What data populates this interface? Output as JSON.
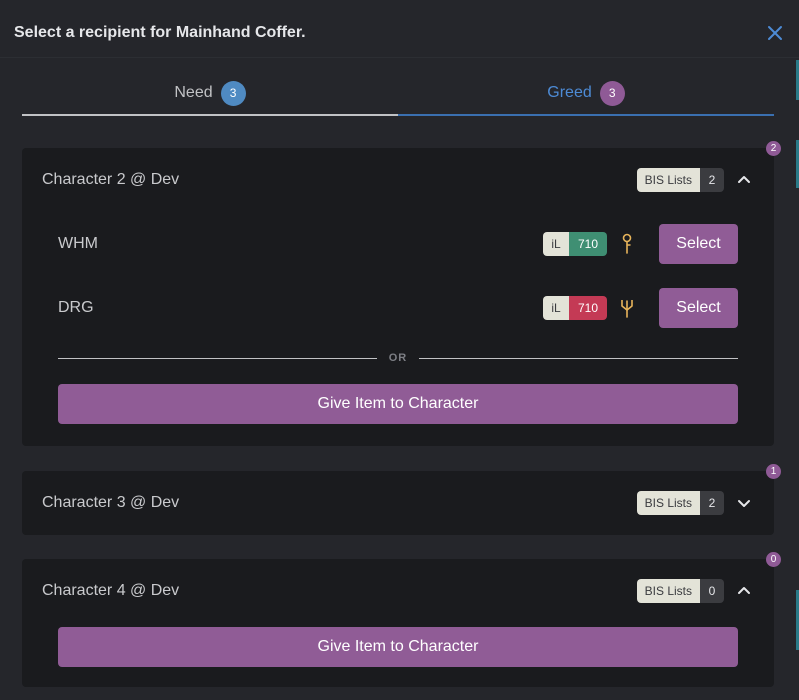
{
  "modal": {
    "title": "Select a recipient for Mainhand Coffer."
  },
  "tabs": [
    {
      "label": "Need",
      "count": "3"
    },
    {
      "label": "Greed",
      "count": "3"
    }
  ],
  "divider_text": "OR",
  "give_label": "Give Item to Character",
  "select_label": "Select",
  "il_label": "iL",
  "bis_label": "BIS Lists",
  "characters": [
    {
      "name": "Character 2 @ Dev",
      "bis_count": "2",
      "corner_count": "2",
      "expanded": true,
      "jobs": [
        {
          "job": "WHM",
          "item_level": "710",
          "il_color": "#3f8f73",
          "icon": "staff-icon"
        },
        {
          "job": "DRG",
          "item_level": "710",
          "il_color": "#c43a55",
          "icon": "spear-icon"
        }
      ]
    },
    {
      "name": "Character 3 @ Dev",
      "bis_count": "2",
      "corner_count": "1",
      "expanded": false
    },
    {
      "name": "Character 4 @ Dev",
      "bis_count": "0",
      "corner_count": "0",
      "expanded": true
    }
  ],
  "colors": {
    "accent": "#905c96",
    "tab_active": "#4d8bd6",
    "background": "#25262b",
    "card": "#1a1b1e"
  }
}
